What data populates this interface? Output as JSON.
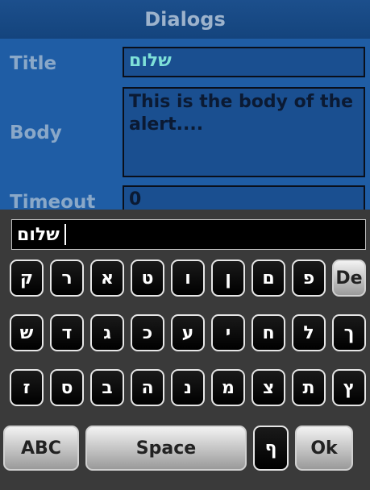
{
  "titlebar": {
    "title": "Dialogs"
  },
  "form": {
    "title_label": "Title",
    "title_value": "שלום",
    "body_label": "Body",
    "body_value": "This is the body of the alert....",
    "timeout_label": "Timeout",
    "timeout_value": "0"
  },
  "keyboard": {
    "input_value": "שלום",
    "row1": [
      "ק",
      "ר",
      "א",
      "ט",
      "ו",
      "ן",
      "ם",
      "פ",
      "De"
    ],
    "row2": [
      "ש",
      "ד",
      "ג",
      "כ",
      "ע",
      "י",
      "ח",
      "ל",
      "ך"
    ],
    "row3": [
      "ז",
      "ס",
      "ב",
      "ה",
      "נ",
      "מ",
      "צ",
      "ת",
      "ץ"
    ],
    "row4": {
      "abc": "ABC",
      "space": "Space",
      "final_pe": "ף",
      "ok": "Ok"
    }
  }
}
